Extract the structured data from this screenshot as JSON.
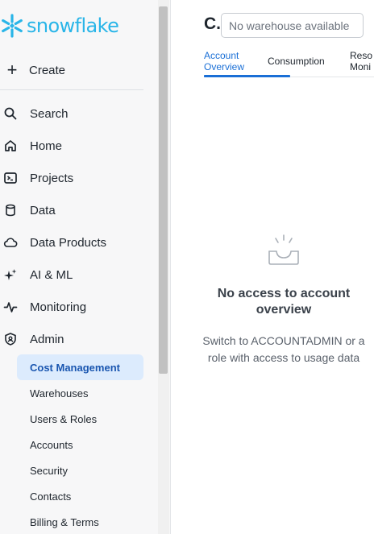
{
  "brand": {
    "logo_text": "snowflake",
    "logo_color": "#29b5e8"
  },
  "sidebar": {
    "create_label": "Create",
    "nav_items": [
      {
        "label": "Search",
        "icon": "search-icon"
      },
      {
        "label": "Home",
        "icon": "home-icon"
      },
      {
        "label": "Projects",
        "icon": "terminal-icon"
      },
      {
        "label": "Data",
        "icon": "database-icon"
      },
      {
        "label": "Data Products",
        "icon": "cloud-icon"
      },
      {
        "label": "AI & ML",
        "icon": "sparkle-icon"
      },
      {
        "label": "Monitoring",
        "icon": "pulse-icon"
      },
      {
        "label": "Admin",
        "icon": "shield-icon"
      }
    ],
    "admin_sub_items": [
      {
        "label": "Cost Management",
        "active": true
      },
      {
        "label": "Warehouses"
      },
      {
        "label": "Users & Roles"
      },
      {
        "label": "Accounts"
      },
      {
        "label": "Security"
      },
      {
        "label": "Contacts"
      },
      {
        "label": "Billing & Terms"
      }
    ]
  },
  "main": {
    "title_fragment": "C.",
    "warehouse_select": {
      "value": "No warehouse available"
    },
    "tabs": [
      {
        "label": "Account Overview",
        "line1": "Account",
        "line2": "Overview",
        "active": true
      },
      {
        "label": "Consumption"
      },
      {
        "label": "Reso… Moni…",
        "line1": "Reso",
        "line2": "Moni"
      }
    ],
    "empty_state": {
      "icon": "empty-tray-icon",
      "title": "No access to account overview",
      "description": "Switch to ACCOUNTADMIN or a role with access to usage data"
    }
  },
  "colors": {
    "accent": "#1a6fd6",
    "active_bg": "#dcebfd"
  }
}
